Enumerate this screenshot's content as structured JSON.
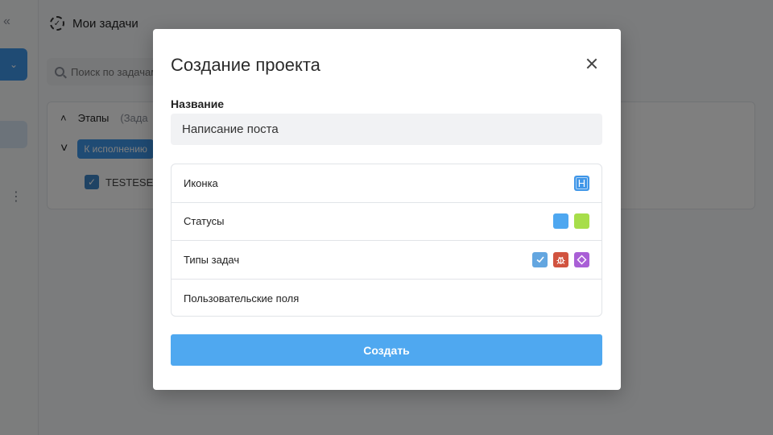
{
  "app": {
    "page_title": "Мои задачи",
    "search": {
      "placeholder": "Поиск по задачам"
    },
    "board": {
      "stages_label": "Этапы",
      "stages_extra": "(Зада",
      "group_label": "К исполнению",
      "task_title": "TESTESEE"
    }
  },
  "modal": {
    "title": "Создание проекта",
    "name_label": "Название",
    "name_value": "Написание поста",
    "settings": {
      "icon_label": "Иконка",
      "icon_letter": "H",
      "icon_color": "#3f96e8",
      "statuses_label": "Статусы",
      "status_colors": [
        "#4ea7f0",
        "#a7de4a"
      ],
      "task_types_label": "Типы задач",
      "task_types": [
        {
          "icon": "check-icon",
          "color": "#63a6e0"
        },
        {
          "icon": "bug-icon",
          "color": "#d1533f"
        },
        {
          "icon": "diamond-icon",
          "color": "#a95fd6"
        }
      ],
      "custom_fields_label": "Пользовательские поля"
    },
    "create_label": "Создать"
  },
  "colors": {
    "primary": "#3f96e8",
    "create_button": "#4fa8f0",
    "overlay": "rgba(0,0,0,0.5)"
  }
}
